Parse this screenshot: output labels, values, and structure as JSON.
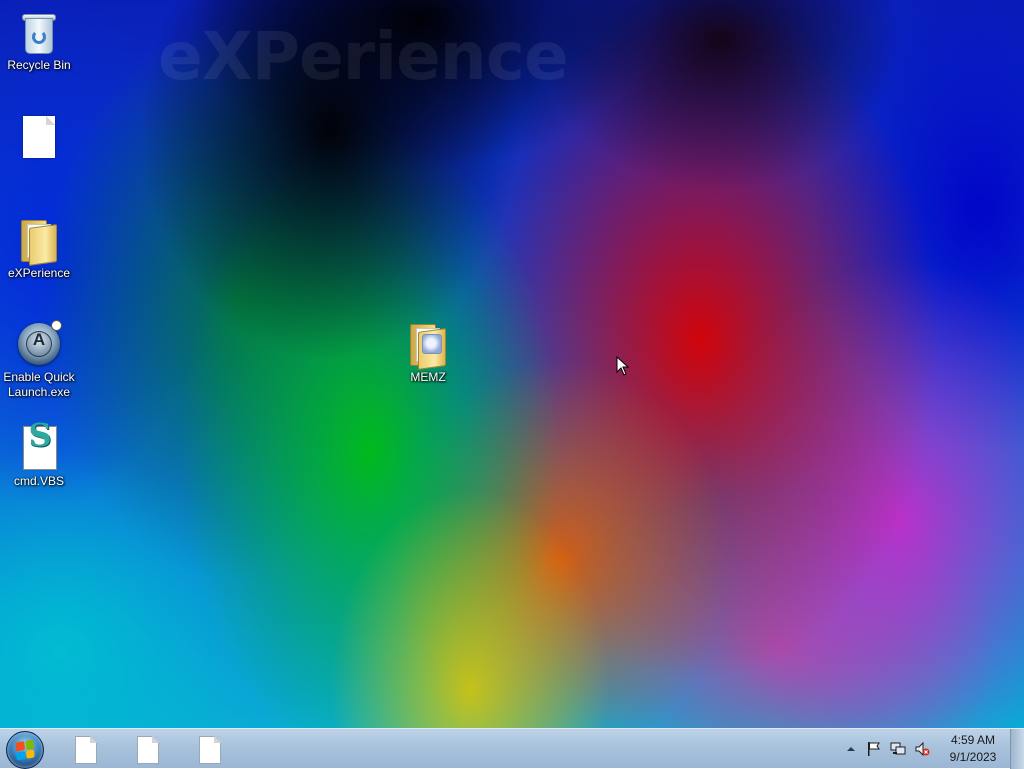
{
  "desktop": {
    "watermark": "eXPerience",
    "icons": [
      {
        "label": "Recycle Bin",
        "icon": "recycle-bin-icon"
      },
      {
        "label": "",
        "icon": "blank-document-icon"
      },
      {
        "label": "eXPerience",
        "icon": "folder-icon"
      },
      {
        "label": "Enable Quick Launch.exe",
        "icon": "quick-launch-app-icon"
      },
      {
        "label": "cmd.VBS",
        "icon": "vbs-script-icon"
      },
      {
        "label": "MEMZ",
        "icon": "folder-with-image-icon"
      }
    ]
  },
  "taskbar": {
    "start_icon": "windows-start-orb-icon",
    "tasks": [
      {
        "icon": "blank-document-icon"
      },
      {
        "icon": "blank-document-icon"
      },
      {
        "icon": "blank-document-icon"
      }
    ],
    "tray": {
      "icons": [
        "show-hidden-icons-arrow",
        "action-center-flag-icon",
        "network-icon",
        "volume-muted-icon"
      ],
      "time": "4:59 AM",
      "date": "9/1/2023"
    }
  },
  "colors": {
    "taskbar": "#a9c2dc",
    "desktop_label": "#ffffff"
  }
}
